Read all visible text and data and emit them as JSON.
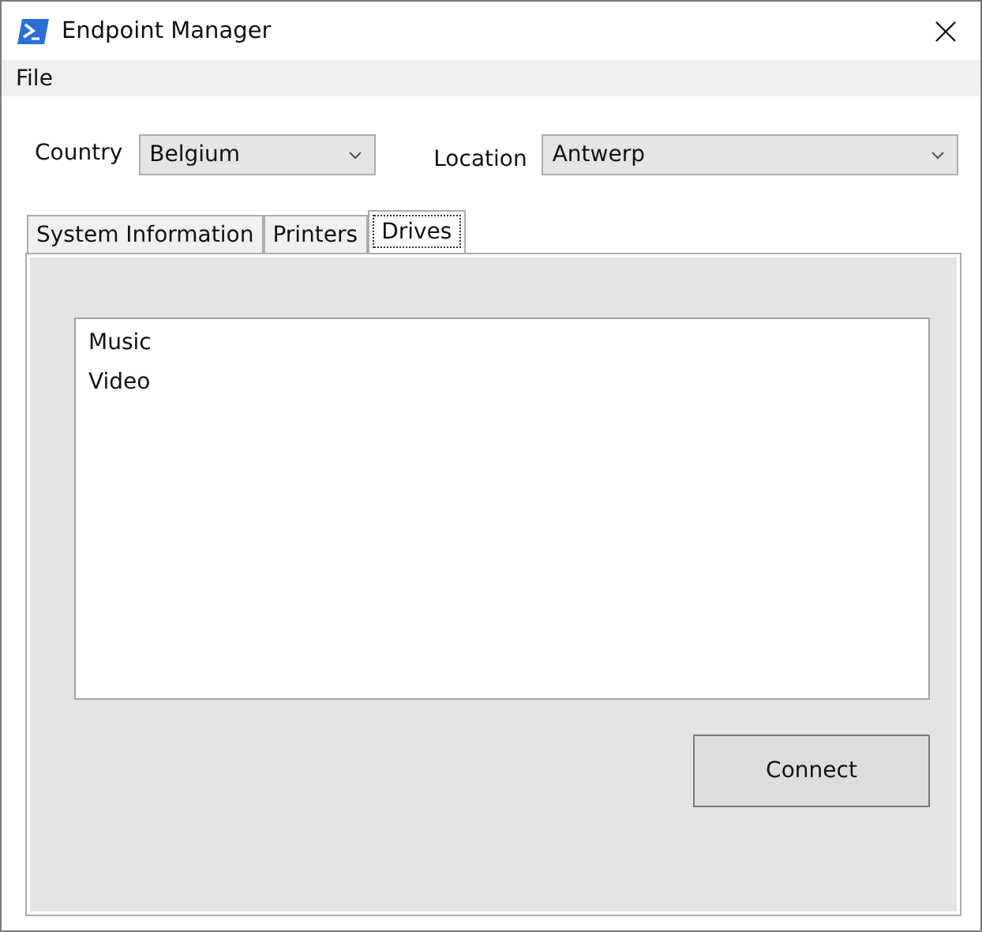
{
  "window": {
    "title": "Endpoint Manager"
  },
  "menu": [
    "File"
  ],
  "country": {
    "label": "Country",
    "value": "Belgium"
  },
  "location": {
    "label": "Location",
    "value": "Antwerp"
  },
  "tabs": [
    {
      "label": "System Information",
      "selected": false
    },
    {
      "label": "Printers",
      "selected": false
    },
    {
      "label": "Drives",
      "selected": true
    }
  ],
  "drives": [
    "Music",
    "Video"
  ],
  "buttons": [
    "Connect"
  ]
}
